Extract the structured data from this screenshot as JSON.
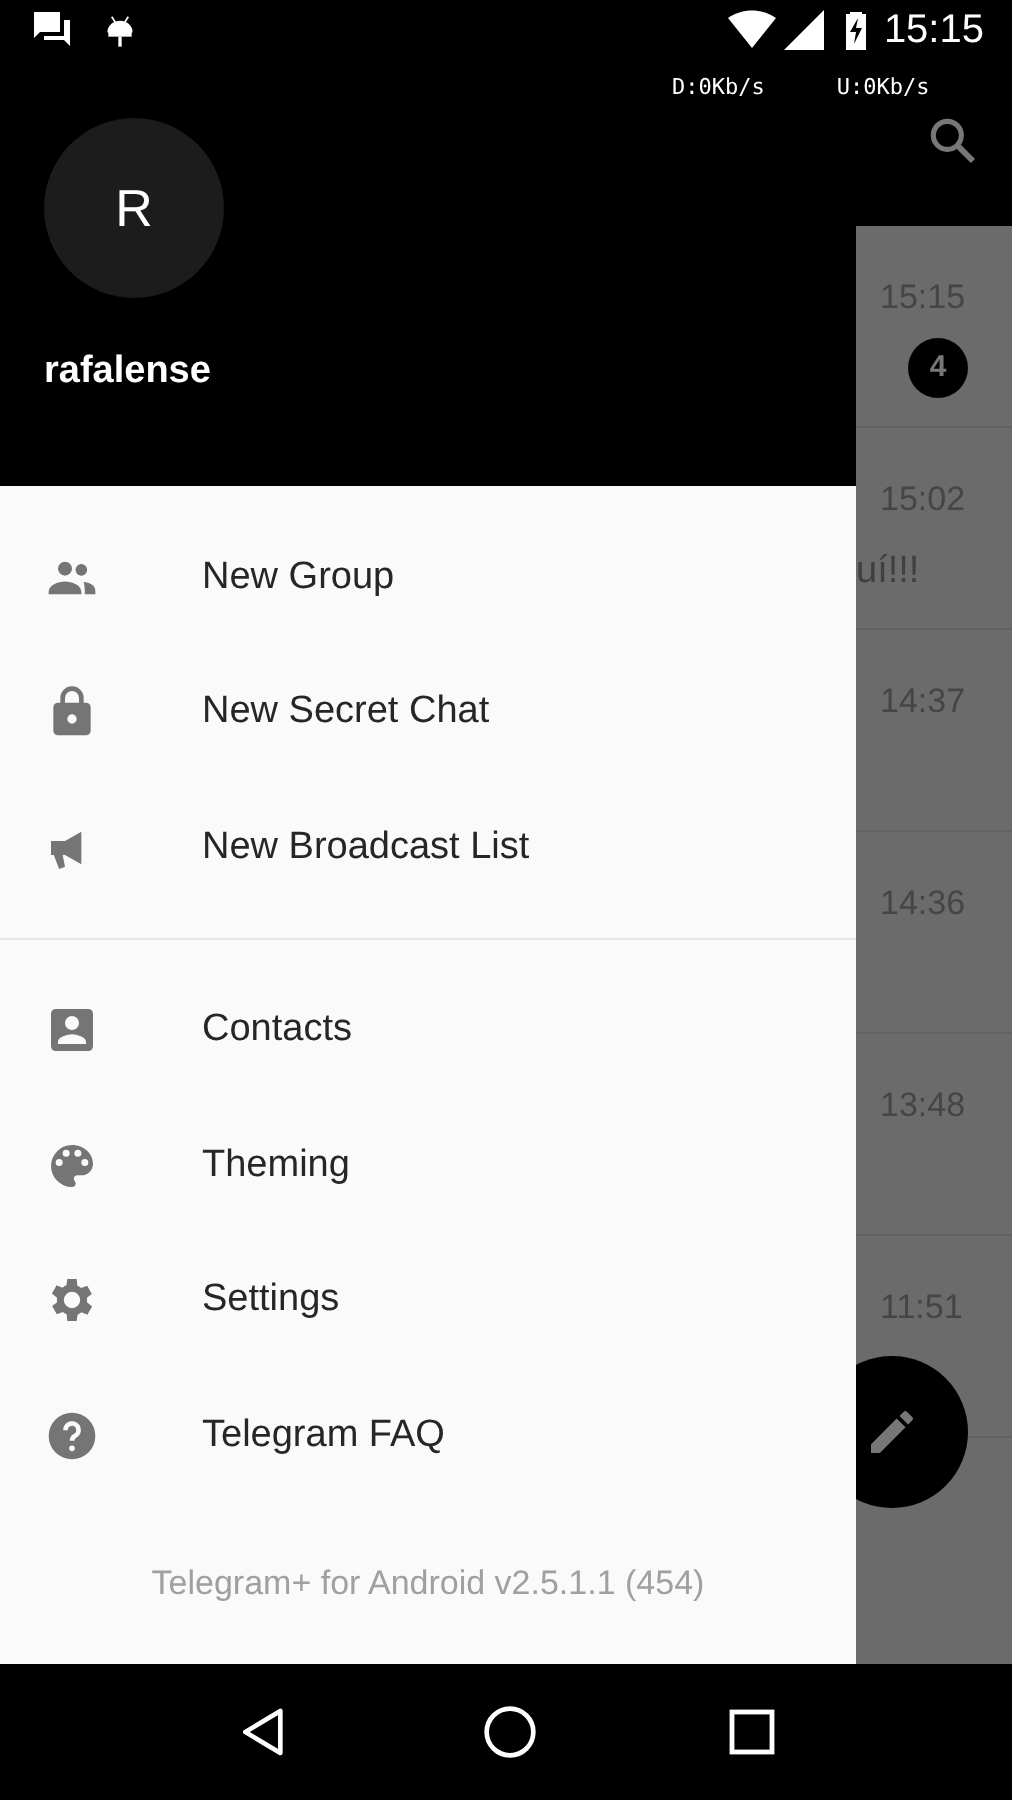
{
  "status_bar": {
    "time": "15:15",
    "net_down": "D:0Kb/s",
    "net_up": "U:0Kb/s"
  },
  "drawer": {
    "avatar_letter": "R",
    "user_name": "rafalense",
    "menu_sections": [
      {
        "items": [
          {
            "label": "New Group"
          },
          {
            "label": "New Secret Chat"
          },
          {
            "label": "New Broadcast List"
          }
        ]
      },
      {
        "items": [
          {
            "label": "Contacts"
          },
          {
            "label": "Theming"
          },
          {
            "label": "Settings"
          },
          {
            "label": "Telegram FAQ"
          }
        ]
      }
    ],
    "version": "Telegram+ for Android v2.5.1.1 (454)"
  },
  "chat_list": {
    "rows": [
      {
        "time": "15:15",
        "badge": "4"
      },
      {
        "time": "15:02",
        "preview": "uí!!!"
      },
      {
        "time": "14:37"
      },
      {
        "time": "14:36"
      },
      {
        "time": "13:48"
      },
      {
        "time": "11:51"
      }
    ]
  }
}
